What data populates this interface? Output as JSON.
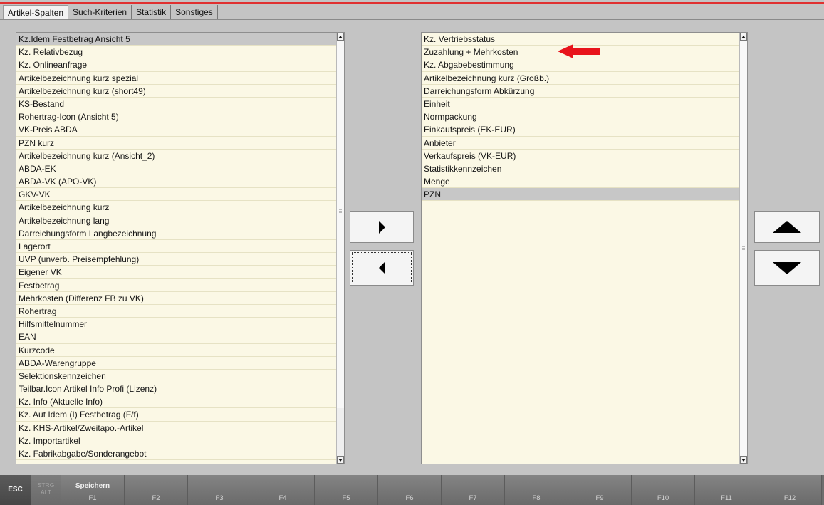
{
  "tabs": [
    "Artikel-Spalten",
    "Such-Kriterien",
    "Statistik",
    "Sonstiges"
  ],
  "available_columns": [
    "Kz.Idem Festbetrag Ansicht 5",
    "Kz. Relativbezug",
    "Kz. Onlineanfrage",
    "Artikelbezeichnung kurz spezial",
    "Artikelbezeichnung kurz (short49)",
    "KS-Bestand",
    "Rohertrag-Icon (Ansicht 5)",
    "VK-Preis ABDA",
    "PZN kurz",
    "Artikelbezeichnung kurz (Ansicht_2)",
    "ABDA-EK",
    "ABDA-VK (APO-VK)",
    "GKV-VK",
    "Artikelbezeichnung kurz",
    "Artikelbezeichnung lang",
    "Darreichungsform Langbezeichnung",
    "Lagerort",
    "UVP (unverb. Preisempfehlung)",
    "Eigener VK",
    "Festbetrag",
    "Mehrkosten (Differenz FB zu VK)",
    "Rohertrag",
    "Hilfsmittelnummer",
    "EAN",
    "Kurzcode",
    "ABDA-Warengruppe",
    "Selektionskennzeichen",
    "Teilbar.Icon Artikel Info Profi (Lizenz)",
    "Kz. Info (Aktuelle Info)",
    "Kz. Aut Idem (I) Festbetrag (F/f)",
    "Kz. KHS-Artikel/Zweitapo.-Artikel",
    "Kz. Importartikel",
    "Kz. Fabrikabgabe/Sonderangebot"
  ],
  "selected_columns": [
    "Kz. Vertriebsstatus",
    "Zuzahlung + Mehrkosten",
    "Kz. Abgabebestimmung",
    "Artikelbezeichnung kurz (Großb.)",
    "Darreichungsform Abkürzung",
    "Einheit",
    "Normpackung",
    "Einkaufspreis (EK-EUR)",
    "Anbieter",
    "Verkaufspreis (VK-EUR)",
    "Statistikkennzeichen",
    "Menge",
    "PZN"
  ],
  "fkeys": [
    {
      "key": "ESC",
      "label": ""
    },
    {
      "key": "STRG",
      "key2": "ALT",
      "label": ""
    },
    {
      "key": "F1",
      "label": "Speichern"
    },
    {
      "key": "F2",
      "label": ""
    },
    {
      "key": "F3",
      "label": ""
    },
    {
      "key": "F4",
      "label": ""
    },
    {
      "key": "F5",
      "label": ""
    },
    {
      "key": "F6",
      "label": ""
    },
    {
      "key": "F7",
      "label": ""
    },
    {
      "key": "F8",
      "label": ""
    },
    {
      "key": "F9",
      "label": ""
    },
    {
      "key": "F10",
      "label": ""
    },
    {
      "key": "F11",
      "label": ""
    },
    {
      "key": "F12",
      "label": ""
    }
  ],
  "colors": {
    "accent_line": "#e03030",
    "annotation_arrow": "#e8141c",
    "list_bg": "#fbf8e5",
    "selected_row": "#c7c7c7"
  },
  "icons": {
    "add": "triangle-right-icon",
    "remove": "triangle-left-icon",
    "move_up": "triangle-up-icon",
    "move_down": "triangle-down-icon"
  }
}
